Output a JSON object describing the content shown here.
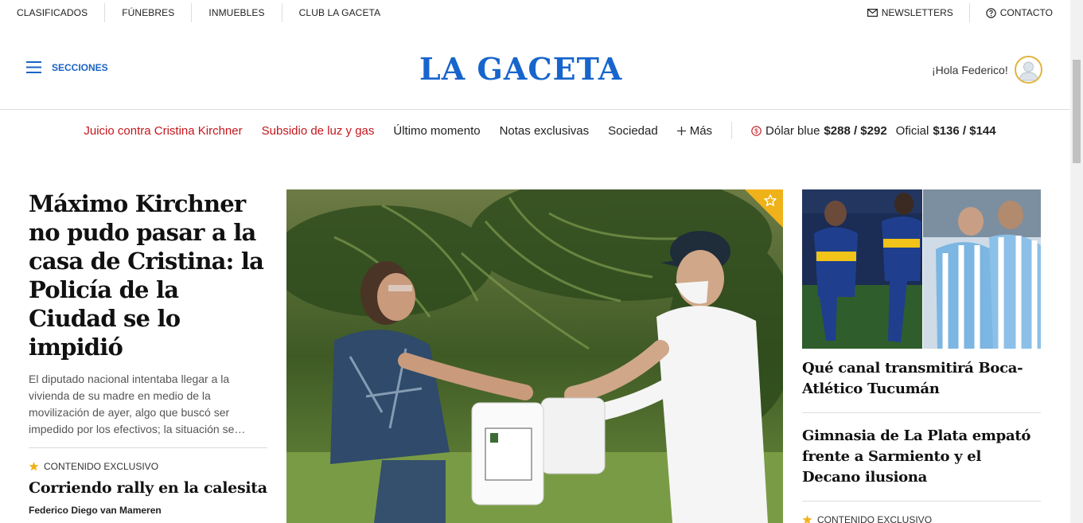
{
  "topbar": {
    "links": [
      "CLASIFICADOS",
      "FÚNEBRES",
      "INMUEBLES",
      "CLUB LA GACETA"
    ],
    "newsletters": "NEWSLETTERS",
    "contacto": "CONTACTO"
  },
  "header": {
    "secciones": "SECCIONES",
    "logo": "LA GACETA",
    "greeting": "¡Hola Federico!"
  },
  "nav": {
    "items": [
      "Juicio contra Cristina Kirchner",
      "Subsidio de luz y gas",
      "Último momento",
      "Notas exclusivas",
      "Sociedad"
    ],
    "mas": "Más",
    "dolar_blue_label": "Dólar blue",
    "dolar_blue_value": "$288 / $292",
    "oficial_label": "Oficial",
    "oficial_value": "$136 / $144"
  },
  "main_story": {
    "headline": "Máximo Kirchner no pudo pasar a la casa de Cristina: la Policía de la Ciudad se lo impidió",
    "summary": "El diputado nacional intentaba llegar a la vivienda de su madre en medio de la movilización de ayer, algo que buscó ser impedido por los efectivos; la situación se…"
  },
  "exclusive_story": {
    "badge": "CONTENIDO EXCLUSIVO",
    "headline": "Corriendo rally en la calesita",
    "author": "Federico Diego van Mameren"
  },
  "right_stories": [
    {
      "headline": "Qué canal transmitirá Boca-Atlético Tucumán"
    },
    {
      "headline": "Gimnasia de La Plata empató frente a Sarmiento y el Decano ilusiona"
    }
  ],
  "right_exclusive_badge": "CONTENIDO EXCLUSIVO",
  "colors": {
    "brand_blue": "#1765cc",
    "accent_red": "#c4161c",
    "star_gold": "#f0b21a"
  }
}
